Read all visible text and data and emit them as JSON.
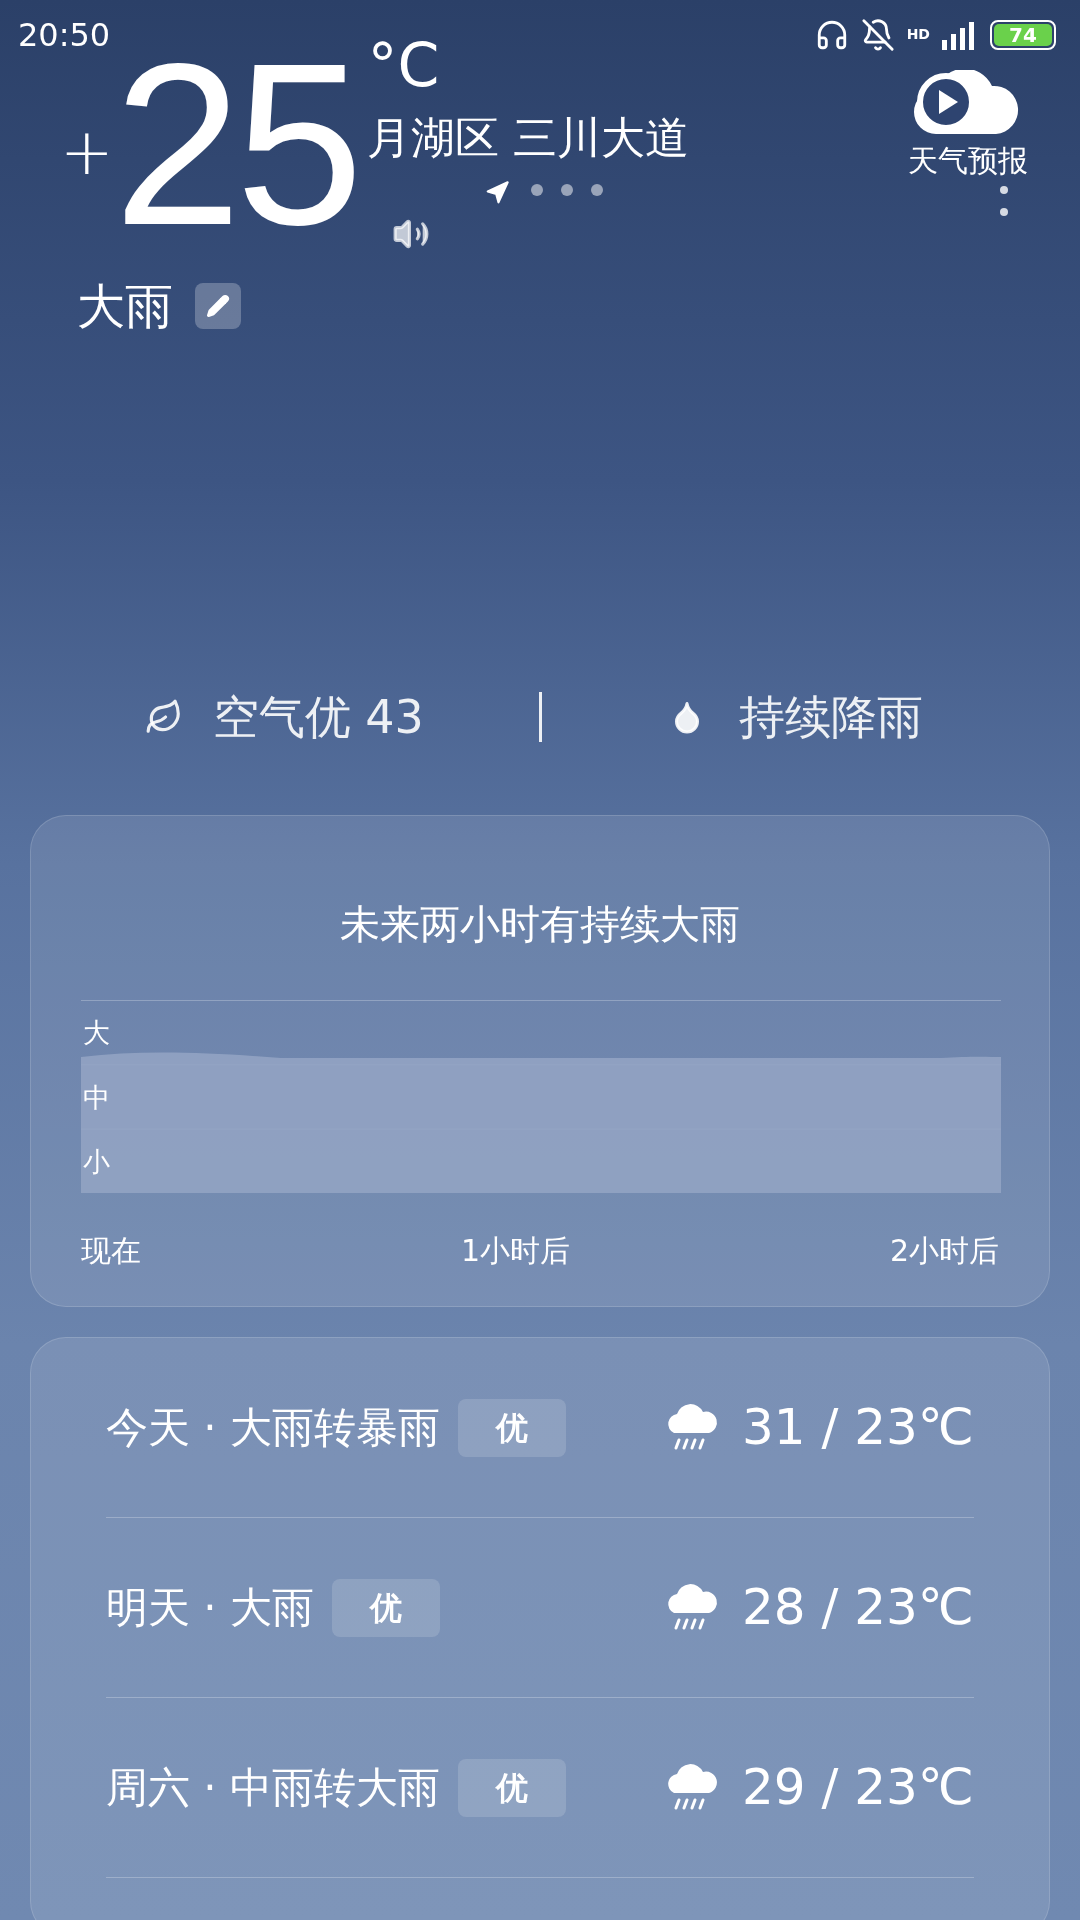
{
  "status_bar": {
    "time": "20:50",
    "network": "HD",
    "battery": "74"
  },
  "current": {
    "sign": "+",
    "temperature": "25",
    "unit": "°C",
    "location": "月湖区 三川大道",
    "pages": [
      {
        "kind": "location",
        "selected": true
      },
      {
        "kind": "dot",
        "selected": false
      },
      {
        "kind": "dot",
        "selected": false
      },
      {
        "kind": "dot",
        "selected": false
      }
    ],
    "condition": "大雨",
    "video_label": "天气预报"
  },
  "summary": {
    "air_quality": "空气优 43",
    "precipitation": "持续降雨"
  },
  "rain_card": {
    "title": "未来两小时有持续大雨",
    "levels": [
      "大",
      "中",
      "小"
    ],
    "times": [
      "现在",
      "1小时后",
      "2小时后"
    ]
  },
  "daily": [
    {
      "label": "今天 · 大雨转暴雨",
      "aqi": "优",
      "temps": "31 / 23℃"
    },
    {
      "label": "明天 · 大雨",
      "aqi": "优",
      "temps": "28 / 23℃"
    },
    {
      "label": "周六 · 中雨转大雨",
      "aqi": "优",
      "temps": "29 / 23℃"
    }
  ]
}
